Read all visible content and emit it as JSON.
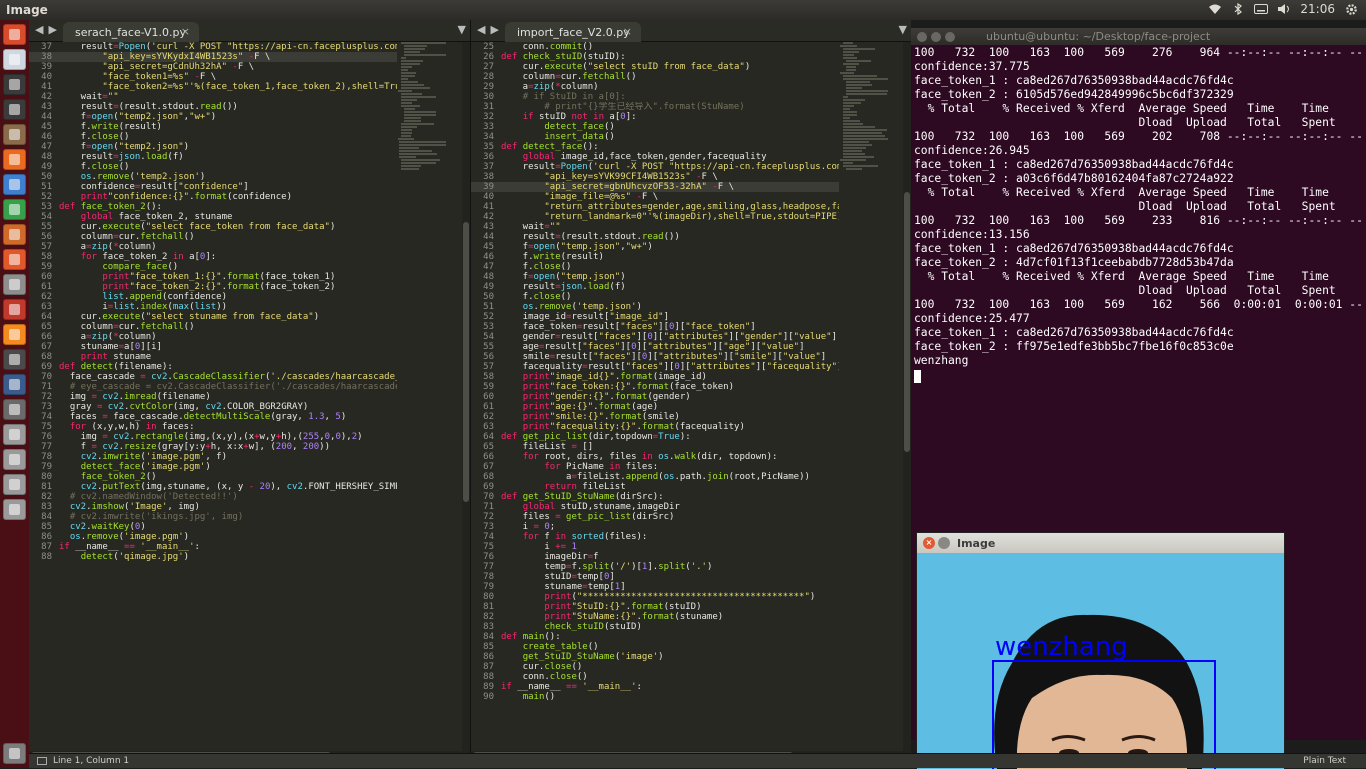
{
  "top_bar": {
    "title": "Image",
    "time": "21:06",
    "icons": [
      "wifi-icon",
      "bluetooth-icon",
      "keyboard-icon",
      "sound-icon",
      "gear-icon"
    ]
  },
  "launcher": {
    "icons": [
      "ubuntu-dash-icon",
      "chrome-icon",
      "terminal-icon",
      "sublime-text-icon",
      "files-icon",
      "firefox-icon",
      "libreoffice-writer-icon",
      "libreoffice-calc-icon",
      "libreoffice-impress-icon",
      "software-center-icon",
      "system-settings-icon",
      "filezilla-icon",
      "vlc-icon",
      "system-monitor-icon",
      "mathematics-icon",
      "workspace-icon",
      "device-icon",
      "device-icon",
      "device-icon",
      "device-icon",
      "trash-icon"
    ],
    "colors": [
      "#d94c2b",
      "#cfd8e0",
      "#3a3a3a",
      "#3b3b3b",
      "#8b6c4a",
      "#e86b1f",
      "#3f7fcf",
      "#36a04a",
      "#d06a2a",
      "#e2582b",
      "#8e8e8e",
      "#c0392b",
      "#f58b1f",
      "#4a4a4a",
      "#3a5c8c",
      "#6a6a6a",
      "#9a9a9a",
      "#9a9a9a",
      "#9a9a9a",
      "#9a9a9a",
      "#7c7c7c"
    ]
  },
  "editor_left": {
    "tab": "serach_face-V1.0.py",
    "active_line": 38,
    "lines": [
      {
        "n": 37,
        "t": "    result=Popen('curl -X POST \"https://api-cn.faceplusplus.com/"
      },
      {
        "n": 38,
        "t": "        \"api_key=sYVKydxI4WB1523s\" -F \\"
      },
      {
        "n": 39,
        "t": "        \"api_secret=gCdnUh32hA\" -F \\"
      },
      {
        "n": 40,
        "t": "        \"face_token1=%s\" -F \\"
      },
      {
        "n": 41,
        "t": "        \"face_token2=%s\"'%(face_token_1,face_token_2),shell=True,"
      },
      {
        "n": 42,
        "t": "    wait=\"\""
      },
      {
        "n": 43,
        "t": "    result=(result.stdout.read())"
      },
      {
        "n": 44,
        "t": "    f=open(\"temp2.json\",\"w+\")"
      },
      {
        "n": 45,
        "t": "    f.write(result)"
      },
      {
        "n": 46,
        "t": "    f.close()"
      },
      {
        "n": 47,
        "t": "    f=open(\"temp2.json\")"
      },
      {
        "n": 48,
        "t": "    result=json.load(f)"
      },
      {
        "n": 49,
        "t": "    f.close()"
      },
      {
        "n": 50,
        "t": "    os.remove('temp2.json')"
      },
      {
        "n": 51,
        "t": "    confidence=result[\"confidence\"]"
      },
      {
        "n": 52,
        "t": "    print\"confidence:{}\".format(confidence)"
      },
      {
        "n": 53,
        "t": "def face_token_2():"
      },
      {
        "n": 54,
        "t": "    global face_token_2, stuname"
      },
      {
        "n": 55,
        "t": "    cur.execute(\"select face_token from face_data\")"
      },
      {
        "n": 56,
        "t": "    column=cur.fetchall()"
      },
      {
        "n": 57,
        "t": "    a=zip(*column)"
      },
      {
        "n": 58,
        "t": "    for face_token_2 in a[0]:"
      },
      {
        "n": 59,
        "t": "        compare_face()"
      },
      {
        "n": 60,
        "t": "        print\"face_token_1:{}\".format(face_token_1)"
      },
      {
        "n": 61,
        "t": "        print\"face_token_2:{}\".format(face_token_2)"
      },
      {
        "n": 62,
        "t": "        list.append(confidence)"
      },
      {
        "n": 63,
        "t": "        i=list.index(max(list))"
      },
      {
        "n": 64,
        "t": "    cur.execute(\"select stuname from face_data\")"
      },
      {
        "n": 65,
        "t": "    column=cur.fetchall()"
      },
      {
        "n": 66,
        "t": "    a=zip(*column)"
      },
      {
        "n": 67,
        "t": "    stuname=a[0][i]"
      },
      {
        "n": 68,
        "t": "    print stuname"
      },
      {
        "n": 69,
        "t": "def detect(filename):"
      },
      {
        "n": 70,
        "t": "  face_cascade = cv2.CascadeClassifier('./cascades/haarcascade_f"
      },
      {
        "n": 71,
        "t": "  # eye_cascade = cv2.CascadeClassifier('./cascades/haarcascade_"
      },
      {
        "n": 72,
        "t": "  img = cv2.imread(filename)"
      },
      {
        "n": 73,
        "t": "  gray = cv2.cvtColor(img, cv2.COLOR_BGR2GRAY)"
      },
      {
        "n": 74,
        "t": "  faces = face_cascade.detectMultiScale(gray, 1.3, 5)"
      },
      {
        "n": 75,
        "t": "  for (x,y,w,h) in faces:"
      },
      {
        "n": 76,
        "t": "    img = cv2.rectangle(img,(x,y),(x+w,y+h),(255,0,0),2)"
      },
      {
        "n": 77,
        "t": "    f = cv2.resize(gray[y:y+h, x:x+w], (200, 200))"
      },
      {
        "n": 78,
        "t": "    cv2.imwrite('image.pgm', f)"
      },
      {
        "n": 79,
        "t": "    detect_face('image.pgm')"
      },
      {
        "n": 80,
        "t": "    face_token_2()"
      },
      {
        "n": 81,
        "t": "    cv2.putText(img,stuname, (x, y - 20), cv2.FONT_HERSHEY_SIMPLE"
      },
      {
        "n": 82,
        "t": "  # cv2.namedWindow('Detected!!')"
      },
      {
        "n": 83,
        "t": "  cv2.imshow('Image', img)"
      },
      {
        "n": 84,
        "t": "  # cv2.imwrite('ikings.jpg', img)"
      },
      {
        "n": 85,
        "t": "  cv2.waitKey(0)"
      },
      {
        "n": 86,
        "t": "  os.remove('image.pgm')"
      },
      {
        "n": 87,
        "t": "if __name__ == '__main__':"
      },
      {
        "n": 88,
        "t": "    detect('qimage.jpg')"
      }
    ]
  },
  "editor_right": {
    "tab": "import_face_V2.0.py",
    "active_line": 39,
    "lines": [
      {
        "n": 25,
        "t": "    conn.commit()"
      },
      {
        "n": 26,
        "t": "def check_stuID(stuID):"
      },
      {
        "n": 27,
        "t": "    cur.execute(\"select stuID from face_data\")"
      },
      {
        "n": 28,
        "t": "    column=cur.fetchall()"
      },
      {
        "n": 29,
        "t": "    a=zip(*column)"
      },
      {
        "n": 30,
        "t": "    # if StuID in a[0]:"
      },
      {
        "n": 31,
        "t": "        # print\"{}学生已经导入\".format(StuName)"
      },
      {
        "n": 32,
        "t": "    if stuID not in a[0]:"
      },
      {
        "n": 33,
        "t": "        detect_face()"
      },
      {
        "n": 34,
        "t": "        insert_data()"
      },
      {
        "n": 35,
        "t": "def detect_face():"
      },
      {
        "n": 36,
        "t": "    global image_id,face_token,gender,facequality"
      },
      {
        "n": 37,
        "t": "    result=Popen('curl -X POST \"https://api-cn.faceplusplus.com/v"
      },
      {
        "n": 38,
        "t": "        \"api_key=sYVK99CFI4WB1523s\" -F \\"
      },
      {
        "n": 39,
        "t": "        \"api_secret=gbnUhcvzOF53-32hA\" -F \\"
      },
      {
        "n": 40,
        "t": "        \"image_file=@%s\" -F \\"
      },
      {
        "n": 41,
        "t": "        \"return_attributes=gender,age,smiling,glass,headpose,fac"
      },
      {
        "n": 42,
        "t": "        \"return_landmark=0\"'%(imageDir),shell=True,stdout=PIPE)"
      },
      {
        "n": 43,
        "t": "    wait=\"\""
      },
      {
        "n": 44,
        "t": "    result=(result.stdout.read())"
      },
      {
        "n": 45,
        "t": "    f=open(\"temp.json\",\"w+\")"
      },
      {
        "n": 46,
        "t": "    f.write(result)"
      },
      {
        "n": 47,
        "t": "    f.close()"
      },
      {
        "n": 48,
        "t": "    f=open(\"temp.json\")"
      },
      {
        "n": 49,
        "t": "    result=json.load(f)"
      },
      {
        "n": 50,
        "t": "    f.close()"
      },
      {
        "n": 51,
        "t": "    os.remove('temp.json')"
      },
      {
        "n": 52,
        "t": "    image_id=result[\"image_id\"]"
      },
      {
        "n": 53,
        "t": "    face_token=result[\"faces\"][0][\"face_token\"]"
      },
      {
        "n": 54,
        "t": "    gender=result[\"faces\"][0][\"attributes\"][\"gender\"][\"value\"]"
      },
      {
        "n": 55,
        "t": "    age=result[\"faces\"][0][\"attributes\"][\"age\"][\"value\"]"
      },
      {
        "n": 56,
        "t": "    smile=result[\"faces\"][0][\"attributes\"][\"smile\"][\"value\"]"
      },
      {
        "n": 57,
        "t": "    facequality=result[\"faces\"][0][\"attributes\"][\"facequality\"]["
      },
      {
        "n": 58,
        "t": "    print\"image_id{}\".format(image_id)"
      },
      {
        "n": 59,
        "t": "    print\"face_token:{}\".format(face_token)"
      },
      {
        "n": 60,
        "t": "    print\"gender:{}\".format(gender)"
      },
      {
        "n": 61,
        "t": "    print\"age:{}\".format(age)"
      },
      {
        "n": 62,
        "t": "    print\"smile:{}\".format(smile)"
      },
      {
        "n": 63,
        "t": "    print\"facequality:{}\".format(facequality)"
      },
      {
        "n": 64,
        "t": "def get_pic_list(dir,topdown=True):"
      },
      {
        "n": 65,
        "t": "    fileList = []"
      },
      {
        "n": 66,
        "t": "    for root, dirs, files in os.walk(dir, topdown):"
      },
      {
        "n": 67,
        "t": "        for PicName in files:"
      },
      {
        "n": 68,
        "t": "            a=fileList.append(os.path.join(root,PicName))"
      },
      {
        "n": 69,
        "t": "        return fileList"
      },
      {
        "n": 70,
        "t": "def get_StuID_StuName(dirSrc):"
      },
      {
        "n": 71,
        "t": "    global stuID,stuname,imageDir"
      },
      {
        "n": 72,
        "t": "    files = get_pic_list(dirSrc)"
      },
      {
        "n": 73,
        "t": "    i = 0;"
      },
      {
        "n": 74,
        "t": "    for f in sorted(files):"
      },
      {
        "n": 75,
        "t": "        i += 1"
      },
      {
        "n": 76,
        "t": "        imageDir=f"
      },
      {
        "n": 77,
        "t": "        temp=f.split('/')[1].split('.')"
      },
      {
        "n": 78,
        "t": "        stuID=temp[0]"
      },
      {
        "n": 79,
        "t": "        stuname=temp[1]"
      },
      {
        "n": 80,
        "t": "        print(\"*****************************************\")"
      },
      {
        "n": 81,
        "t": "        print\"StuID:{}\".format(stuID)"
      },
      {
        "n": 82,
        "t": "        print\"StuName:{}\".format(stuname)"
      },
      {
        "n": 83,
        "t": "        check_stuID(stuID)"
      },
      {
        "n": 84,
        "t": "def main():"
      },
      {
        "n": 85,
        "t": "    create_table()"
      },
      {
        "n": 86,
        "t": "    get_StuID_StuName('image')"
      },
      {
        "n": 87,
        "t": "    cur.close()"
      },
      {
        "n": 88,
        "t": "    conn.close()"
      },
      {
        "n": 89,
        "t": "if __name__ == '__main__':"
      },
      {
        "n": 90,
        "t": "    main()"
      }
    ]
  },
  "terminal": {
    "title": "ubuntu@ubuntu: ~/Desktop/face-project",
    "lines": [
      "100   732  100   163  100   569    276    964 --:--:-- --:--:-- --",
      "confidence:37.775",
      "face_token_1 : ca8ed267d76350938bad44acdc76fd4c",
      "face_token_2 : 6105d576ed942849996c5bc6df372329",
      "  % Total    % Received % Xferd  Average Speed   Time    Time",
      "                                 Dload  Upload   Total   Spent",
      "100   732  100   163  100   569    202    708 --:--:-- --:--:-- --",
      "confidence:26.945",
      "face_token_1 : ca8ed267d76350938bad44acdc76fd4c",
      "face_token_2 : a03c6f6d47b80162404fa87c2724a922",
      "  % Total    % Received % Xferd  Average Speed   Time    Time",
      "                                 Dload  Upload   Total   Spent",
      "100   732  100   163  100   569    233    816 --:--:-- --:--:-- --",
      "confidence:13.156",
      "face_token_1 : ca8ed267d76350938bad44acdc76fd4c",
      "face_token_2 : 4d7cf01f13f1ceebabdb7728d53b47da",
      "  % Total    % Received % Xferd  Average Speed   Time    Time",
      "                                 Dload  Upload   Total   Spent",
      "100   732  100   163  100   569    162    566  0:00:01  0:00:01 --",
      "confidence:25.477",
      "face_token_1 : ca8ed267d76350938bad44acdc76fd4c",
      "face_token_2 : ff975e1edfe3bb5bc7fbe16f0c853c0e",
      "wenzhang"
    ]
  },
  "image_window": {
    "title": "Image",
    "label": "wenzhang",
    "box_color": "#0000ff",
    "background_color": "#5dbde2"
  },
  "status_bar": {
    "position": "Line 1, Column 1",
    "syntax": "Plain Text"
  },
  "colors": {
    "keyword": "#f92672",
    "string": "#e6db74",
    "function": "#a6e22e",
    "builtin": "#66d9ef",
    "comment": "#75715e",
    "number": "#ae81ff",
    "text": "#f8f8f2"
  }
}
